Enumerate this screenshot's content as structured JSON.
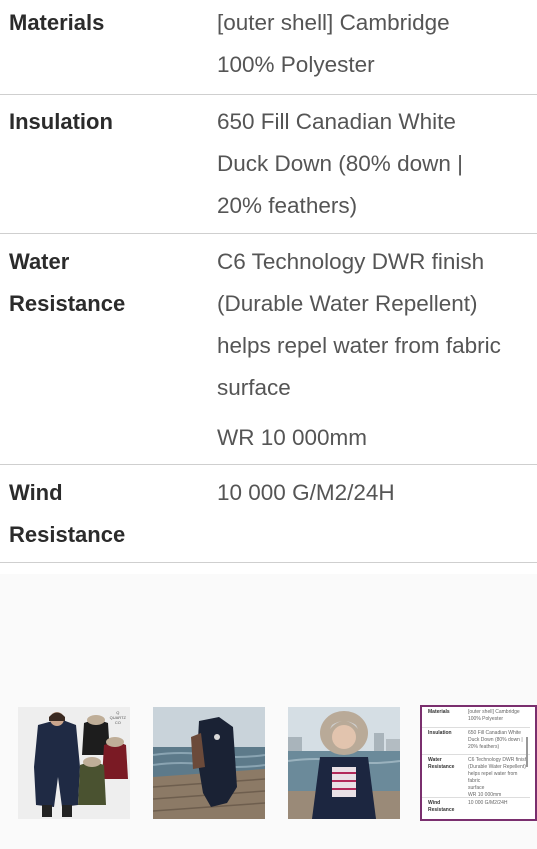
{
  "specs": {
    "materials": {
      "label": "Materials",
      "lines": [
        "[outer shell] Cambridge",
        "100% Polyester"
      ]
    },
    "insulation": {
      "label": "Insulation",
      "lines": [
        "650 Fill Canadian White",
        "Duck Down (80% down |",
        "20% feathers)"
      ]
    },
    "water": {
      "label_lines": [
        "Water",
        "Resistance"
      ],
      "lines": [
        "C6 Technology DWR finish",
        "(Durable Water Repellent)",
        "helps repel water from fabric",
        "surface"
      ],
      "extra": "WR 10 000mm"
    },
    "wind": {
      "label_lines": [
        "Wind",
        "Resistance"
      ],
      "lines": [
        "10 000 G/M2/24H"
      ]
    }
  },
  "thumbnails": [
    {
      "name": "thumb-product-colors",
      "brand": [
        "Q",
        "QUARTZ",
        "CO"
      ]
    },
    {
      "name": "thumb-dock-scene"
    },
    {
      "name": "thumb-waterfront-model"
    },
    {
      "name": "thumb-spec-table",
      "active": true
    }
  ],
  "colors": {
    "accent": "#7a2f6e",
    "divider": "#cfcfcf"
  }
}
